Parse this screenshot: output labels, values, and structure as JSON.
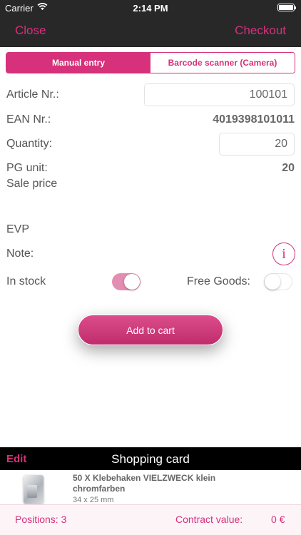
{
  "status_bar": {
    "carrier": "Carrier",
    "time": "2:14 PM"
  },
  "nav": {
    "close": "Close",
    "checkout": "Checkout"
  },
  "tabs": [
    {
      "label": "Manual entry",
      "active": true
    },
    {
      "label": "Barcode scanner (Camera)",
      "active": false
    }
  ],
  "form": {
    "article_label": "Article Nr.:",
    "article_value": "100101",
    "ean_label": "EAN Nr.:",
    "ean_value": "4019398101011",
    "quantity_label": "Quantity:",
    "quantity_value": "20",
    "pg_unit_label": "PG unit:",
    "pg_unit_value": "20",
    "sale_price_label": "Sale price",
    "evp_label": "EVP",
    "note_label": "Note:",
    "info_glyph": "i",
    "in_stock_label": "In stock",
    "in_stock_on": true,
    "free_goods_label": "Free Goods:",
    "free_goods_on": false
  },
  "add_to_cart": "Add to cart",
  "cart": {
    "edit": "Edit",
    "title": "Shopping card",
    "items": [
      {
        "name": "50 X Klebehaken VIELZWECK klein chromfarben",
        "size": "34 x 25 mm",
        "icon": "product-thumbnail"
      }
    ]
  },
  "footer": {
    "positions_label": "Positions: 3",
    "contract_value_label": "Contract value:",
    "contract_value": "0 €"
  },
  "colors": {
    "accent": "#d6317a",
    "nav_bg": "#282828",
    "toggle_on": "#e48db3"
  }
}
